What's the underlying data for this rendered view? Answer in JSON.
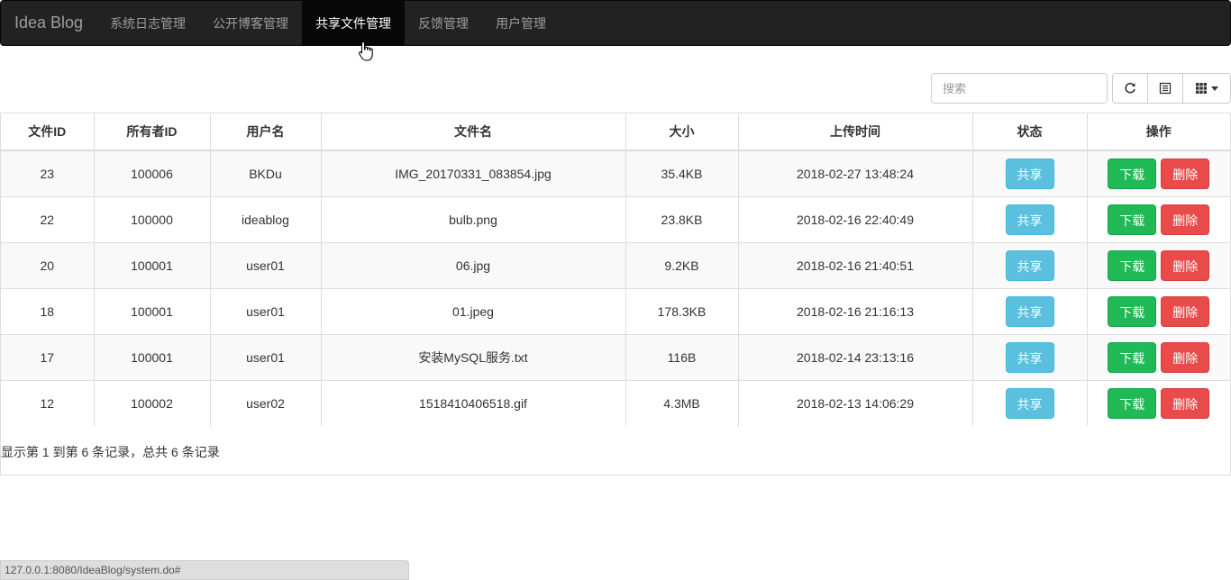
{
  "navbar": {
    "brand": "Idea Blog",
    "items": [
      {
        "label": "系统日志管理"
      },
      {
        "label": "公开博客管理"
      },
      {
        "label": "共享文件管理"
      },
      {
        "label": "反馈管理"
      },
      {
        "label": "用户管理"
      }
    ],
    "active_index": 2
  },
  "toolbar": {
    "search_placeholder": "搜索",
    "icons": [
      "refresh-icon",
      "list-toggle-icon",
      "columns-grid-icon",
      "caret-down-icon"
    ]
  },
  "table": {
    "headers": [
      "文件ID",
      "所有者ID",
      "用户名",
      "文件名",
      "大小",
      "上传时间",
      "状态",
      "操作"
    ],
    "rows": [
      {
        "file_id": "23",
        "owner_id": "100006",
        "username": "BKDu",
        "filename": "IMG_20170331_083854.jpg",
        "size": "35.4KB",
        "upload_time": "2018-02-27 13:48:24",
        "status": "共享",
        "download": "下载",
        "delete": "删除"
      },
      {
        "file_id": "22",
        "owner_id": "100000",
        "username": "ideablog",
        "filename": "bulb.png",
        "size": "23.8KB",
        "upload_time": "2018-02-16 22:40:49",
        "status": "共享",
        "download": "下载",
        "delete": "删除"
      },
      {
        "file_id": "20",
        "owner_id": "100001",
        "username": "user01",
        "filename": "06.jpg",
        "size": "9.2KB",
        "upload_time": "2018-02-16 21:40:51",
        "status": "共享",
        "download": "下载",
        "delete": "删除"
      },
      {
        "file_id": "18",
        "owner_id": "100001",
        "username": "user01",
        "filename": "01.jpeg",
        "size": "178.3KB",
        "upload_time": "2018-02-16 21:16:13",
        "status": "共享",
        "download": "下载",
        "delete": "删除"
      },
      {
        "file_id": "17",
        "owner_id": "100001",
        "username": "user01",
        "filename": "安装MySQL服务.txt",
        "size": "116B",
        "upload_time": "2018-02-14 23:13:16",
        "status": "共享",
        "download": "下载",
        "delete": "删除"
      },
      {
        "file_id": "12",
        "owner_id": "100002",
        "username": "user02",
        "filename": "1518410406518.gif",
        "size": "4.3MB",
        "upload_time": "2018-02-13 14:06:29",
        "status": "共享",
        "download": "下载",
        "delete": "删除"
      }
    ]
  },
  "pagination": {
    "info": "显示第 1 到第 6 条记录，总共 6 条记录"
  },
  "statusbar": {
    "url": "127.0.0.1:8080/IdeaBlog/system.do#"
  },
  "colors": {
    "navbar_bg": "#222222",
    "share_button": "#5bc0de",
    "download_button": "#1fb955",
    "delete_button": "#e94a4a"
  }
}
